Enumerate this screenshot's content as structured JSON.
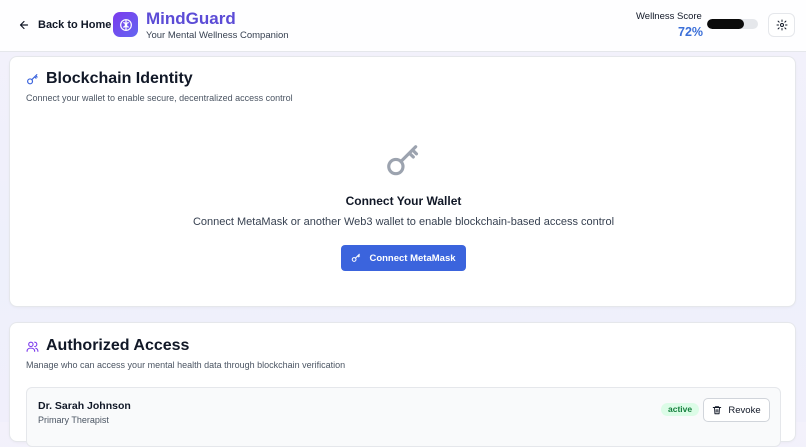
{
  "header": {
    "back_label": "Back to Home",
    "app_name": "MindGuard",
    "tagline": "Your Mental Wellness Companion",
    "wellness_label": "Wellness Score",
    "wellness_value": "72%",
    "wellness_fraction": 0.72
  },
  "identity": {
    "title": "Blockchain Identity",
    "subtitle": "Connect your wallet to enable secure, decentralized access control",
    "connect_heading": "Connect Your Wallet",
    "connect_description": "Connect MetaMask or another Web3 wallet to enable blockchain-based access control",
    "connect_button": "Connect MetaMask"
  },
  "access": {
    "title": "Authorized Access",
    "subtitle": "Manage who can access your mental health data through blockchain verification",
    "entries": [
      {
        "name": "Dr. Sarah Johnson",
        "role": "Primary Therapist",
        "status": "active",
        "action": "Revoke"
      }
    ]
  },
  "colors": {
    "accent": "#3b64dd",
    "brand": "#5b4bd6",
    "status_active": "#15803d"
  }
}
